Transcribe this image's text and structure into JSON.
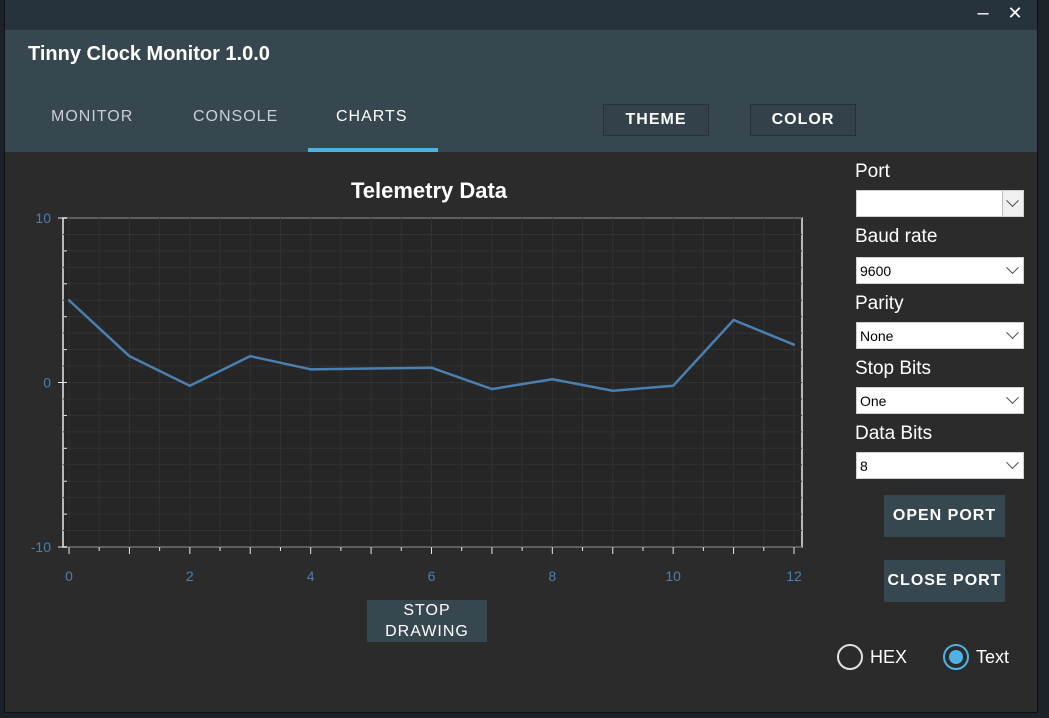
{
  "window": {
    "minimize_glyph": "–",
    "close_glyph": "✕"
  },
  "app": {
    "title": "Tinny Clock Monitor 1.0.0"
  },
  "tabs": [
    {
      "label": "MONITOR",
      "active": false
    },
    {
      "label": "CONSOLE",
      "active": false
    },
    {
      "label": "CHARTS",
      "active": true
    }
  ],
  "header_buttons": {
    "theme": "THEME",
    "color": "COLOR"
  },
  "chart_data": {
    "type": "line",
    "title": "Telemetry Data",
    "xlabel": "",
    "ylabel": "",
    "x": [
      0,
      1,
      2,
      3,
      4,
      5,
      6,
      7,
      8,
      9,
      10,
      11,
      12
    ],
    "series": [
      {
        "values": [
          5,
          1.6,
          -0.2,
          1.6,
          0.8,
          0.85,
          0.9,
          -0.4,
          0.2,
          -0.5,
          -0.2,
          3.8,
          2.3
        ]
      }
    ],
    "xlim": [
      0,
      12
    ],
    "ylim": [
      -10,
      10
    ],
    "x_ticks": [
      "0",
      "2",
      "4",
      "6",
      "8",
      "10",
      "12"
    ],
    "y_ticks": [
      "10",
      "0",
      "-10"
    ],
    "grid": true,
    "line_color": "#4a7fb0"
  },
  "stop_button": {
    "label": "STOP\nDRAWING"
  },
  "serial": {
    "port_label": "Port",
    "port_value": "",
    "baud_label": "Baud rate",
    "baud_value": "9600",
    "parity_label": "Parity",
    "parity_value": "None",
    "stopbits_label": "Stop Bits",
    "stopbits_value": "One",
    "databits_label": "Data Bits",
    "databits_value": "8",
    "open_port": "OPEN PORT",
    "close_port": "CLOSE PORT"
  },
  "format": {
    "hex_label": "HEX",
    "text_label": "Text",
    "selected": "Text"
  },
  "colors": {
    "accent": "#4fb2e6",
    "appbar": "#37474f",
    "background": "#2b2b2b"
  }
}
